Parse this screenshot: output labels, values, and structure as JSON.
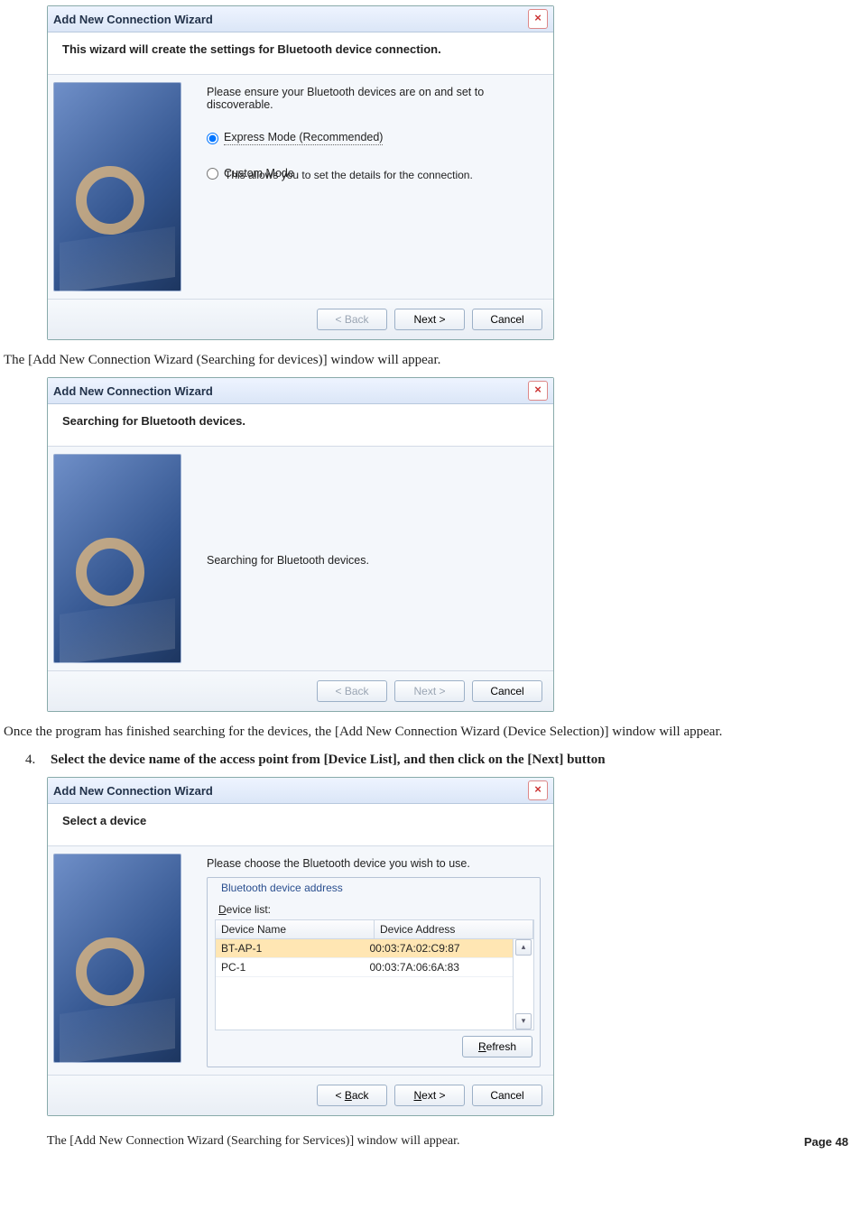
{
  "dlg1": {
    "title": "Add New Connection Wizard",
    "header": "This wizard will create the settings for Bluetooth device connection.",
    "intro": "Please ensure your Bluetooth devices are on and set to discoverable.",
    "radio_express": "Express Mode (Recommended)",
    "radio_custom": "Custom Mode",
    "custom_sub": "This allows you to set the details for the connection.",
    "back": "< Back",
    "next": "Next >",
    "cancel": "Cancel"
  },
  "narr1": "The [Add New Connection Wizard (Searching for devices)] window will appear.",
  "dlg2": {
    "title": "Add New Connection Wizard",
    "header": "Searching for Bluetooth devices.",
    "body_text": "Searching for Bluetooth devices.",
    "back": "< Back",
    "next": "Next >",
    "cancel": "Cancel"
  },
  "narr2": "Once the program has finished searching for the devices, the [Add New Connection Wizard (Device Selection)] window will appear.",
  "step4_num": "4.",
  "step4": "Select the device name of the access point from [Device List], and then click on the [Next] button",
  "dlg3": {
    "title": "Add New Connection Wizard",
    "header": "Select a device",
    "intro": "Please choose the Bluetooth device you wish to use.",
    "group_title": "Bluetooth device address",
    "list_label_pre": "D",
    "list_label_post": "evice list:",
    "col_name": "Device Name",
    "col_addr": "Device Address",
    "rows": [
      {
        "name": "BT-AP-1",
        "addr": "00:03:7A:02:C9:87"
      },
      {
        "name": "PC-1",
        "addr": "00:03:7A:06:6A:83"
      }
    ],
    "refresh_u": "R",
    "refresh_rest": "efresh",
    "back_u": "B",
    "back_pre": "< ",
    "back_post": "ack",
    "next_u": "N",
    "next_post": "ext >",
    "cancel": "Cancel"
  },
  "narr3": "The [Add New Connection Wizard (Searching for Services)] window will appear.",
  "page_label": "Page 48"
}
